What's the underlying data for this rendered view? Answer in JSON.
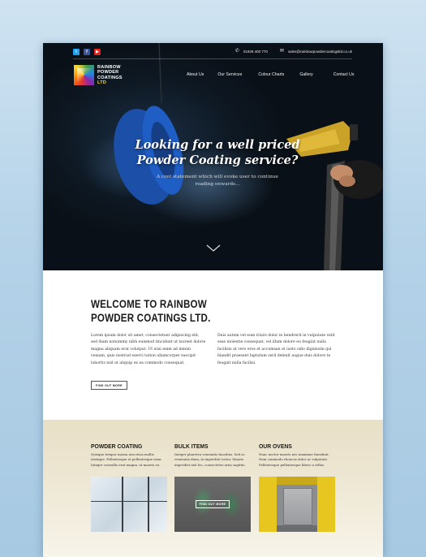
{
  "header": {
    "social": [
      "t",
      "f",
      "▶"
    ],
    "phone": "01929 400 770",
    "email": "sales@rainbowpowdercoatingsltd.co.uk"
  },
  "logo": {
    "line1": "RAINBOW",
    "line2": "POWDER",
    "line3": "COATINGS",
    "line4": "LTD"
  },
  "nav": {
    "items": [
      {
        "label": "About Us"
      },
      {
        "label": "Our Services"
      },
      {
        "label": "Colour Charts"
      },
      {
        "label": "Gallery"
      },
      {
        "label": "Contact Us"
      }
    ]
  },
  "hero": {
    "title_line1": "Looking for a well priced",
    "title_line2": "Powder Coating service?",
    "sub_line1": "A cool statement which will evoke user to continue",
    "sub_line2": "reading onwards..."
  },
  "welcome": {
    "title_line1": "WELCOME TO RAINBOW",
    "title_line2": "POWDER COATINGS LTD.",
    "col_left": "Lorem ipsum dolor sit amet, consectetuer adipiscing elit, sed diam nonummy nibh euismod tincidunt ut laoreet dolore magna aliquam erat volutpat. Ut wisi enim ad minim veniam, quis nostrud exerci tation ullamcorper suscipit lobortis nisl ut aliquip ex ea commodo consequat.",
    "col_right": "Duis autem vel eum iriure dolor in hendrerit in vulputate velit esse molestie consequat, vel illum dolore eu feugiat nulla facilisis at vero eros et accumsan et iusto odio dignissim qui blandit praesent luptatum zzril delenit augue duis dolore te feugait nulla facilisi.",
    "button": "FIND OUT MORE"
  },
  "services": [
    {
      "title": "POWDER COATING",
      "desc": "Quisque tempor massa non risus mollis tristique. Pellentesque et pellentesque urna. Integer convallis erat magna, ut mauris eu."
    },
    {
      "title": "BULK ITEMS",
      "desc": "Integer pharetra venenatis faucibus. Sed ac venenatis diam, in imperdiet tortor. Mauris imperdiet nisl leo, consectetur urna sagittis.",
      "button": "FIND OUT MORE"
    },
    {
      "title": "OUR OVENS",
      "desc": "Nunc auctor mauris nec maximus tincidunt. Nam commodo rhoncus dolor ac vulputate. Pellentesque pellentesque libero a tellus."
    }
  ]
}
